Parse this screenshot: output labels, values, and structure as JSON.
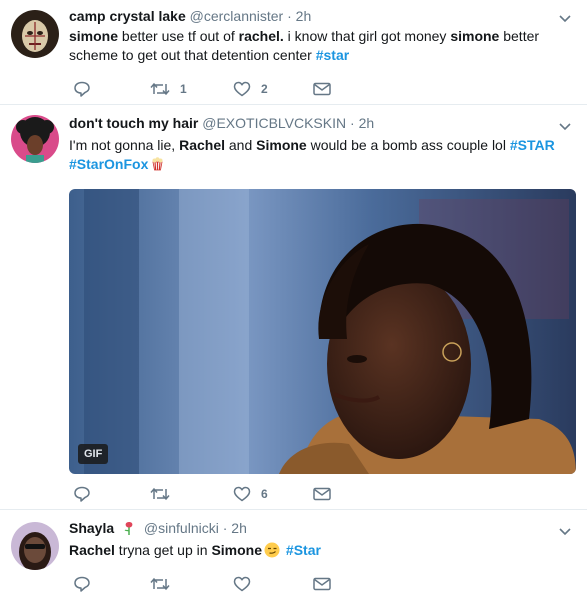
{
  "tweets": [
    {
      "name": "camp crystal lake",
      "handle": "@cerclannister",
      "dot": "·",
      "time": "2h",
      "body": [
        {
          "t": "simone",
          "b": true
        },
        {
          "t": " better use tf out of "
        },
        {
          "t": "rachel.",
          "b": true
        },
        {
          "t": " i know that girl got money "
        },
        {
          "t": "simone",
          "b": true
        },
        {
          "t": " better scheme to get out that detention center "
        },
        {
          "t": "#star",
          "tag": true
        }
      ],
      "reply_count": "",
      "retweet_count": "1",
      "like_count": "2"
    },
    {
      "name": "don't touch my hair",
      "handle": "@EXOTICBLVCKSKIN",
      "dot": "·",
      "time": "2h",
      "body": [
        {
          "t": "I'm not gonna lie, "
        },
        {
          "t": "Rachel",
          "b": true
        },
        {
          "t": " and "
        },
        {
          "t": "Simone",
          "b": true
        },
        {
          "t": " would be a bomb ass couple lol "
        },
        {
          "t": "#STAR",
          "tag": true
        },
        {
          "t": " "
        },
        {
          "t": "#StarOnFox",
          "tag": true
        }
      ],
      "media_badge": "GIF",
      "reply_count": "",
      "retweet_count": "",
      "like_count": "6"
    },
    {
      "name": "Shayla",
      "handle": "@sinfulnicki",
      "dot": "·",
      "time": "2h",
      "body": [
        {
          "t": "Rachel",
          "b": true
        },
        {
          "t": " tryna get up in "
        },
        {
          "t": "Simone",
          "b": true
        },
        {
          "t": " "
        },
        {
          "t": "#Star",
          "tag": true
        }
      ],
      "reply_count": "",
      "retweet_count": "",
      "like_count": ""
    }
  ],
  "icons": {
    "reply": "reply-icon",
    "retweet": "retweet-icon",
    "like": "heart-icon",
    "dm": "envelope-icon",
    "caret": "chevron-down-icon"
  },
  "colors": {
    "text": "#14171a",
    "secondary": "#657786",
    "link": "#1b95e0",
    "border": "#e6ecf0"
  }
}
